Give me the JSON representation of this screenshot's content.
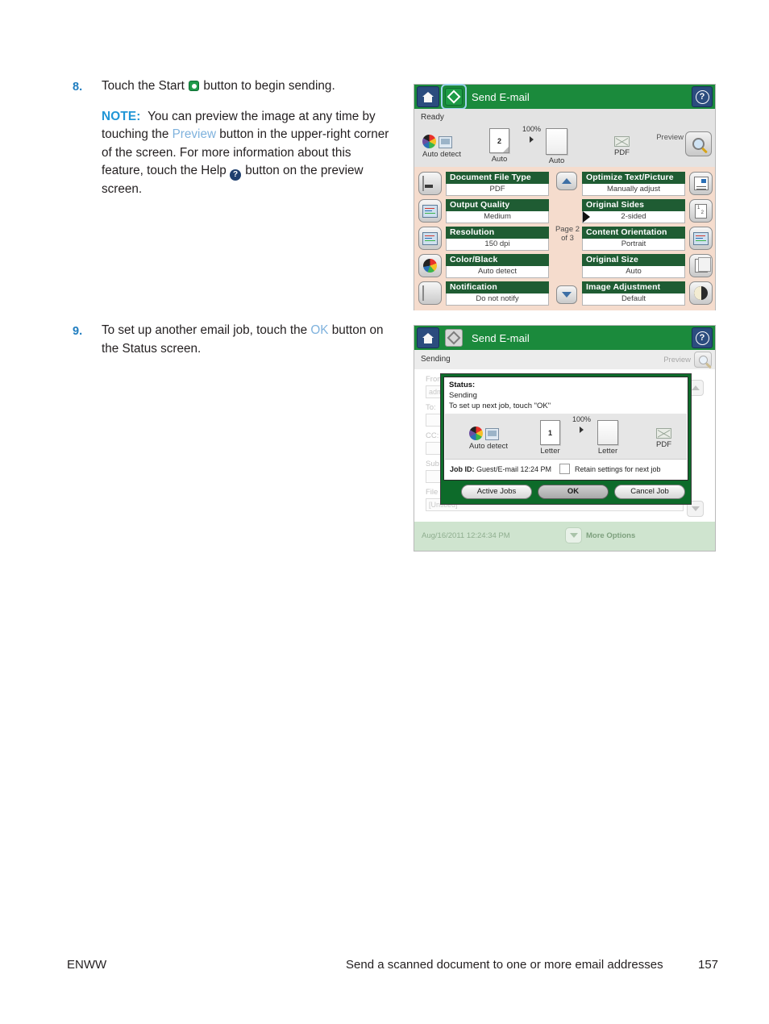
{
  "doc": {
    "step8": {
      "number": "8.",
      "text_before": "Touch the Start ",
      "icon": "start-icon",
      "text_after": " button to begin sending.",
      "note_label": "NOTE:",
      "note_p1": "You can preview the image at any time by touching the ",
      "note_link": "Preview",
      "note_p2": " button in the upper-right corner of the screen. For more information about this feature, touch the Help ",
      "note_help_icon": "help-icon",
      "note_p3": " button on the preview screen."
    },
    "step9": {
      "number": "9.",
      "text_before": "To set up another email job, touch the ",
      "link": "OK",
      "text_after": " button on the Status screen."
    }
  },
  "footer": {
    "left": "ENWW",
    "center": "Send a scanned document to one or more email addresses",
    "page": "157"
  },
  "screen1": {
    "header": {
      "home_icon": "home-icon",
      "start_icon": "start-icon",
      "title": "Send E-mail",
      "help_icon": "help-icon"
    },
    "status": "Ready",
    "strip": {
      "color_label": "Auto detect",
      "original_count": "2",
      "original_label": "Auto",
      "zoom": "100%",
      "output_label": "Auto",
      "file_type": "PDF",
      "preview_label": "Preview"
    },
    "page_indicator_line1": "Page 2",
    "page_indicator_line2": "of 3",
    "settings_left": [
      {
        "title": "Document File Type",
        "value": "PDF",
        "icon": "document-icon"
      },
      {
        "title": "Output Quality",
        "value": "Medium",
        "icon": "quality-icon"
      },
      {
        "title": "Resolution",
        "value": "150 dpi",
        "icon": "resolution-icon"
      },
      {
        "title": "Color/Black",
        "value": "Auto detect",
        "icon": "color-wheel-icon"
      },
      {
        "title": "Notification",
        "value": "Do not notify",
        "icon": "notification-icon"
      }
    ],
    "settings_right": [
      {
        "title": "Optimize Text/Picture",
        "value": "Manually adjust",
        "icon": "text-picture-icon"
      },
      {
        "title": "Original Sides",
        "value": "2-sided",
        "icon": "two-sided-icon"
      },
      {
        "title": "Content Orientation",
        "value": "Portrait",
        "icon": "orientation-icon"
      },
      {
        "title": "Original Size",
        "value": "Auto",
        "icon": "paper-size-icon"
      },
      {
        "title": "Image Adjustment",
        "value": "Default",
        "icon": "image-adjust-icon"
      }
    ]
  },
  "screen2": {
    "header": {
      "home_icon": "home-icon",
      "start_icon": "start-icon",
      "title": "Send E-mail",
      "help_icon": "help-icon"
    },
    "status": "Sending",
    "preview_label": "Preview",
    "form": {
      "from_label": "From:",
      "from_value": "adm",
      "to_label": "To:",
      "to_value": "",
      "cc_label": "CC:",
      "cc_value": "",
      "subject_label": "Sub",
      "subject_value": "",
      "filename_label": "File",
      "filename_value": "[Untitled]"
    },
    "dialog": {
      "status_label": "Status:",
      "status_value": "Sending",
      "instruction": "To set up next job, touch \"OK\"",
      "color_label": "Auto detect",
      "original_count": "1",
      "original_label": "Letter",
      "zoom": "100%",
      "output_label": "Letter",
      "file_type": "PDF",
      "job_id_label": "Job ID:",
      "job_id_value": "Guest/E-mail 12:24 PM",
      "retain_label": "Retain settings for next job",
      "buttons": {
        "active_jobs": "Active Jobs",
        "ok": "OK",
        "cancel_job": "Cancel Job"
      }
    },
    "timestamp": "Aug/16/2011 12:24:34 PM",
    "more_options": "More Options"
  },
  "colors": {
    "header_green": "#1b8a3c",
    "settings_green": "#1f5c33",
    "settings_bg": "#f5dccd",
    "link_blue": "#7fb2dd",
    "note_blue": "#2196d6",
    "step_blue": "#1f7dc0"
  }
}
